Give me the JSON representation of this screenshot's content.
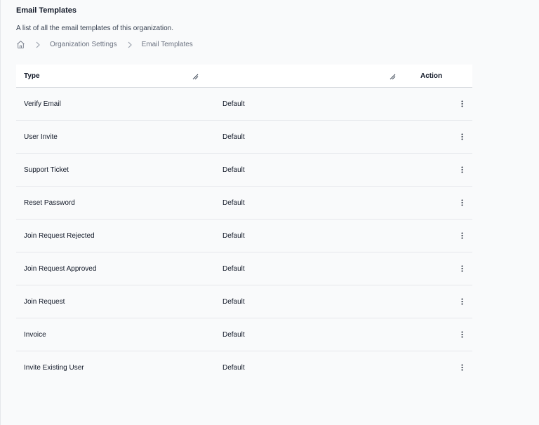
{
  "page": {
    "title": "Email Templates",
    "description": "A list of all the email templates of this organization."
  },
  "breadcrumb": {
    "home_icon": "home-icon",
    "separator_icon": "chevron-right-icon",
    "items": [
      "Organization Settings",
      "Email Templates"
    ]
  },
  "table": {
    "headers": {
      "type": "Type",
      "status": "",
      "action": "Action"
    },
    "action_icon": "kebab-vertical-icon",
    "rows": [
      {
        "type": "Verify Email",
        "status": "Default"
      },
      {
        "type": "User Invite",
        "status": "Default"
      },
      {
        "type": "Support Ticket",
        "status": "Default"
      },
      {
        "type": "Reset Password",
        "status": "Default"
      },
      {
        "type": "Join Request Rejected",
        "status": "Default"
      },
      {
        "type": "Join Request Approved",
        "status": "Default"
      },
      {
        "type": "Join Request",
        "status": "Default"
      },
      {
        "type": "Invoice",
        "status": "Default"
      },
      {
        "type": "Invite Existing User",
        "status": "Default"
      }
    ]
  }
}
